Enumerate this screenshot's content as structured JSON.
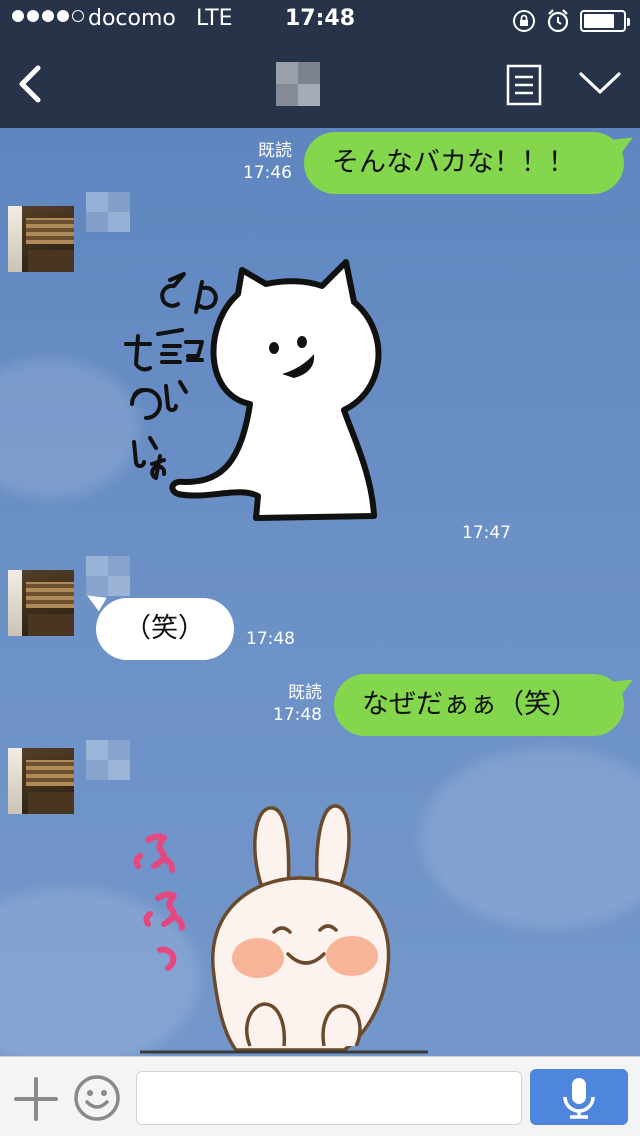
{
  "status_bar": {
    "carrier": "docomo",
    "network": "LTE",
    "time": "17:48"
  },
  "header": {
    "back_icon": "chevron-left-icon",
    "menu_icon": "list-icon",
    "collapse_icon": "chevron-down-icon"
  },
  "messages": [
    {
      "type": "sent_text",
      "text": "そんなバカな！！！",
      "read": "既読",
      "time": "17:46"
    },
    {
      "type": "received_sticker",
      "sticker": "white cat sticker",
      "sticker_text": "その話もういいょ",
      "time": "17:47"
    },
    {
      "type": "received_text",
      "text": "（笑）",
      "time": "17:48"
    },
    {
      "type": "sent_text",
      "text": "なぜだぁぁ（笑）",
      "read": "既読",
      "time": "17:48"
    },
    {
      "type": "received_sticker",
      "sticker": "bunny sticker",
      "sticker_text": "ふふっ"
    }
  ],
  "input_bar": {
    "placeholder": "",
    "plus_icon": "plus-icon",
    "emoji_icon": "smiley-icon",
    "mic_icon": "microphone-icon"
  },
  "colors": {
    "header_bg": "#263348",
    "sent_bubble": "#84d74d",
    "received_bubble": "#ffffff",
    "mic_button": "#4f86dd"
  }
}
